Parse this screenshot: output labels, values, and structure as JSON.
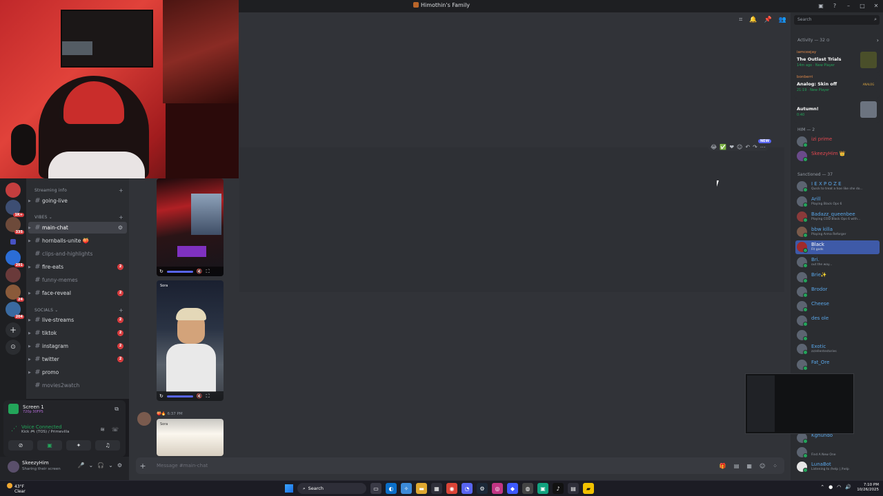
{
  "window": {
    "title": "Himothin's Family"
  },
  "server": {
    "categories": [
      {
        "label": "Streaming info",
        "channels": [
          {
            "name": "going-live",
            "state": "normal"
          }
        ]
      },
      {
        "label": "VIBES",
        "channels": [
          {
            "name": "main-chat",
            "state": "active"
          },
          {
            "name": "hornballs-unite 🍑",
            "state": "normal"
          },
          {
            "name": "clips-and-highlights",
            "state": "muted"
          },
          {
            "name": "fire-eats",
            "state": "normal",
            "badge": "2"
          },
          {
            "name": "funny-memes",
            "state": "muted"
          },
          {
            "name": "face-reveal",
            "state": "normal",
            "badge": "2"
          }
        ]
      },
      {
        "label": "SOCIALS",
        "channels": [
          {
            "name": "live-streams",
            "state": "normal",
            "badge": "2"
          },
          {
            "name": "tiktok",
            "state": "normal",
            "badge": "2"
          },
          {
            "name": "instagram",
            "state": "normal",
            "badge": "2"
          },
          {
            "name": "twitter",
            "state": "normal",
            "badge": "2"
          },
          {
            "name": "promo",
            "state": "normal"
          },
          {
            "name": "movies2watch",
            "state": "muted"
          }
        ]
      }
    ],
    "rail_badges": [
      "1K+",
      "335",
      "201",
      "24",
      "204"
    ]
  },
  "voice": {
    "stream_title": "Screen 1",
    "stream_sub": "720p 30FPS",
    "status": "Voice Connected",
    "channel": "Kick 🎮 (TOS) / Primevilla"
  },
  "user": {
    "name": "SkeezyHim",
    "status": "Sharing their screen"
  },
  "chat": {
    "new_tag": "NEW",
    "msg_time": "6:37 PM",
    "sora_label": "Sora",
    "composer_placeholder": "Message #main-chat"
  },
  "members": {
    "search_placeholder": "Search",
    "activity_header": "Activity — 32",
    "activities": [
      {
        "user": "iamceejay",
        "game": "The Outlast Trials",
        "detail": "14m ago · New Player"
      },
      {
        "user": "bonberri",
        "game": "Analog: Skin off",
        "detail": "21:19 · New Player"
      },
      {
        "user": "",
        "game": "Autumn!",
        "detail": "0:40"
      }
    ],
    "groups": [
      {
        "label": "HIM — 2",
        "items": [
          {
            "name": "izi prime",
            "status": ""
          },
          {
            "name": "SkeezyHim 👑",
            "status": ""
          }
        ]
      },
      {
        "label": "Sanctioned — 37",
        "items": [
          {
            "name": "I E X P O Z E",
            "status": "Quick to treat a hoe like she do..."
          },
          {
            "name": "Arill",
            "status": "Playing Black Ops 6"
          },
          {
            "name": "Badazz_queenbee",
            "status": "Playing COD Black Ops 6 with..."
          },
          {
            "name": "bbw killa",
            "status": "Playing Arma Reforger"
          },
          {
            "name": "Black",
            "status": "Fit gods"
          },
          {
            "name": "Bri.",
            "status": "out the way..."
          },
          {
            "name": "Brie✨",
            "status": ""
          },
          {
            "name": "Brodor",
            "status": ""
          },
          {
            "name": "Cheese",
            "status": ""
          },
          {
            "name": "des ole",
            "status": ""
          },
          {
            "name": "",
            "status": ""
          },
          {
            "name": "Exotic",
            "status": "zz/ellentestories"
          },
          {
            "name": "Fat_Ore",
            "status": ""
          }
        ]
      },
      {
        "label": "",
        "items": [
          {
            "name": "Kghundo",
            "status": ""
          },
          {
            "name": "",
            "status": "Find A New One"
          },
          {
            "name": "LunaBot",
            "status": "Listening to /help | /help"
          }
        ]
      }
    ]
  },
  "taskbar": {
    "temp": "43°F",
    "cond": "Clear",
    "search": "Search",
    "time": "7:10 PM",
    "date": "10/26/2025"
  },
  "colors": {
    "accent": "#5865f2",
    "online": "#23a55a",
    "danger": "#d83c3e"
  }
}
